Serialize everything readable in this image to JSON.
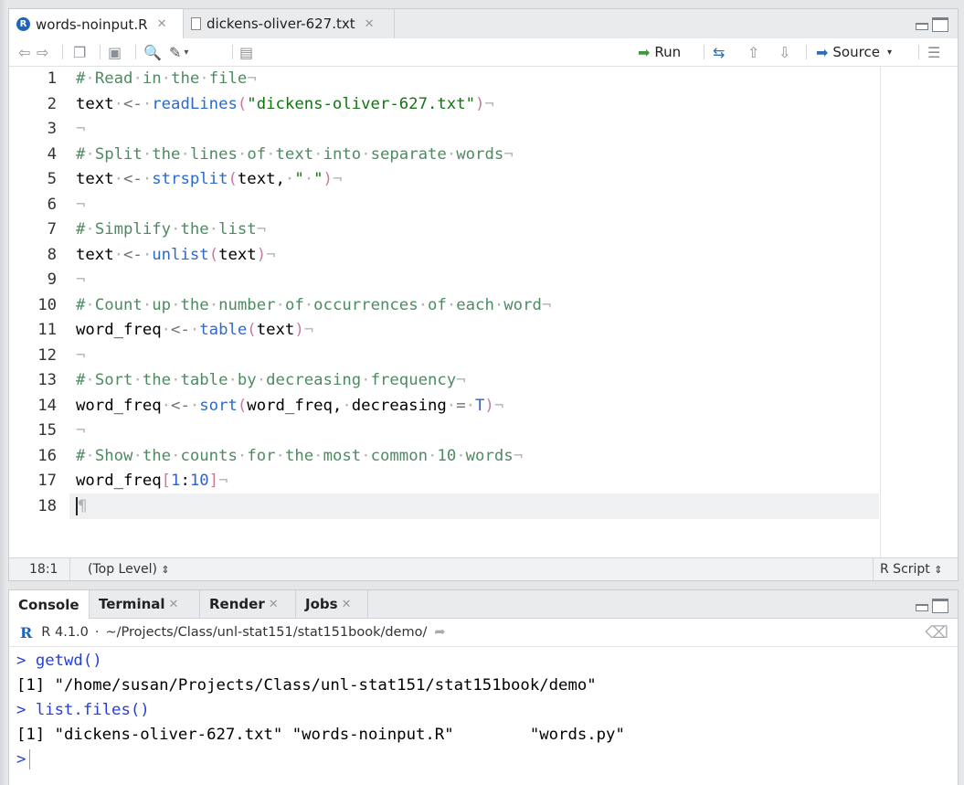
{
  "source": {
    "tabs": [
      {
        "label": "words-noinput.R",
        "active": true,
        "icon": "r-file-icon"
      },
      {
        "label": "dickens-oliver-627.txt",
        "active": false,
        "icon": "text-file-icon"
      }
    ],
    "toolbar": {
      "run_label": "Run",
      "source_label": "Source"
    },
    "line_numbers": [
      "1",
      "2",
      "3",
      "4",
      "5",
      "6",
      "7",
      "8",
      "9",
      "10",
      "11",
      "12",
      "13",
      "14",
      "15",
      "16",
      "17",
      "18"
    ],
    "lines": [
      "# Read in the file",
      "text <- readLines(\"dickens-oliver-627.txt\")",
      "",
      "# Split the lines of text into separate words",
      "text <- strsplit(text, \" \")",
      "",
      "# Simplify the list",
      "text <- unlist(text)",
      "",
      "# Count up the number of occurrences of each word",
      "word_freq <- table(text)",
      "",
      "# Sort the table by decreasing frequency",
      "word_freq <- sort(word_freq, decreasing = T)",
      "",
      "# Show the counts for the most common 10 words",
      "word_freq[1:10]",
      ""
    ],
    "status": {
      "position": "18:1",
      "scope": "(Top Level)",
      "file_type": "R Script"
    }
  },
  "console": {
    "tabs": [
      {
        "label": "Console",
        "active": true
      },
      {
        "label": "Terminal",
        "active": false
      },
      {
        "label": "Render",
        "active": false
      },
      {
        "label": "Jobs",
        "active": false
      }
    ],
    "r_version": "R 4.1.0",
    "separator": "·",
    "working_dir": "~/Projects/Class/unl-stat151/stat151book/demo/",
    "prompt": ">",
    "output": [
      {
        "type": "cmd",
        "text": "getwd()"
      },
      {
        "type": "out",
        "text": "[1] \"/home/susan/Projects/Class/unl-stat151/stat151book/demo\""
      },
      {
        "type": "cmd",
        "text": "list.files()"
      },
      {
        "type": "out",
        "text": "[1] \"dickens-oliver-627.txt\" \"words-noinput.R\"        \"words.py\""
      },
      {
        "type": "cmd",
        "text": ""
      }
    ]
  }
}
